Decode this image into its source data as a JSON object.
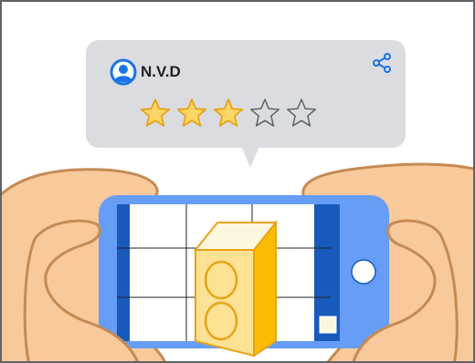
{
  "review": {
    "username": "N.V.D",
    "rating": 3,
    "max_rating": 5
  },
  "icons": {
    "avatar": "account-circle-icon",
    "share": "share-icon",
    "star": "star-icon"
  },
  "colors": {
    "bubble": "#dadce0",
    "avatar_blue": "#1a73e8",
    "star_filled": "#fdd663",
    "star_outline": "#5f6368",
    "phone_blue": "#669df6",
    "phone_dark": "#185abc",
    "skin": "#f8c99b",
    "skin_line": "#c58a53",
    "box_yellow": "#fcd34d"
  }
}
